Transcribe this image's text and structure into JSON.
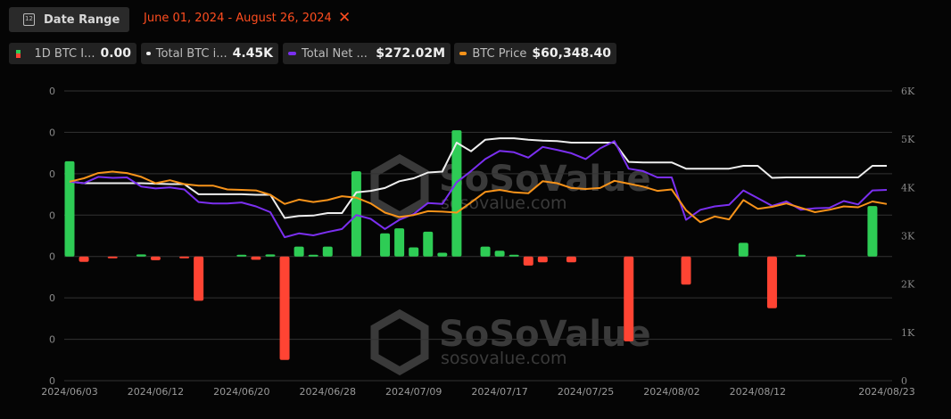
{
  "header": {
    "date_range_button": "Date Range",
    "calendar_icon_text": "12",
    "selected_range": "June 01, 2024 - August 26, 2024",
    "close_glyph": "✕"
  },
  "legend": [
    {
      "name": "1D BTC I...",
      "value": "0.00",
      "colors": [
        "#2ecc55",
        "#ff4433"
      ]
    },
    {
      "name": "Total BTC i...",
      "value": "4.45K",
      "color": "#eeeeee"
    },
    {
      "name": "Total Net ...",
      "value": "$272.02M",
      "color": "#7b2ff0"
    },
    {
      "name": "BTC Price",
      "value": "$60,348.40",
      "color": "#f7931a"
    }
  ],
  "watermark": {
    "brand": "SoSoValue",
    "url": "sosovalue.com"
  },
  "chart_data": {
    "type": "bar+line",
    "title": "",
    "left_axis": {
      "tick_labels": [
        "0",
        "0",
        "0",
        "0",
        "0",
        "0",
        "0",
        "0"
      ],
      "ylim": [
        -3,
        4
      ],
      "note": "bar units (gridline steps)"
    },
    "right_axis": {
      "tick_labels": [
        "6K",
        "5K",
        "4K",
        "3K",
        "2K",
        "1K",
        "0"
      ],
      "ylim": [
        0,
        6
      ]
    },
    "x_tick_labels": [
      {
        "index": 0,
        "label": "2024/06/03"
      },
      {
        "index": 6,
        "label": "2024/06/12"
      },
      {
        "index": 12,
        "label": "2024/06/20"
      },
      {
        "index": 18,
        "label": "2024/06/28"
      },
      {
        "index": 24,
        "label": "2024/07/09"
      },
      {
        "index": 30,
        "label": "2024/07/17"
      },
      {
        "index": 36,
        "label": "2024/07/25"
      },
      {
        "index": 42,
        "label": "2024/08/02"
      },
      {
        "index": 48,
        "label": "2024/08/12"
      },
      {
        "index": 57,
        "label": "2024/08/23"
      }
    ],
    "bars": {
      "name": "1D BTC Inflow",
      "positive_color": "#2ecc55",
      "negative_color": "#ff4433",
      "values": [
        2.3,
        -0.13,
        0,
        -0.02,
        0,
        0.05,
        -0.09,
        0,
        -0.01,
        -1.07,
        0,
        0,
        0.02,
        -0.08,
        0.05,
        -2.5,
        0.24,
        0.04,
        0.24,
        0,
        2.06,
        0,
        0.56,
        0.68,
        0.22,
        0.6,
        0.09,
        3.05,
        0,
        0.24,
        0.14,
        0.01,
        -0.22,
        -0.14,
        0,
        -0.14,
        0,
        0,
        0,
        -2.05,
        0,
        0,
        0,
        -0.68,
        0,
        0,
        0,
        0.33,
        0,
        -1.25,
        0,
        0.02,
        0,
        0,
        0,
        0,
        1.22,
        0
      ]
    },
    "series": [
      {
        "name": "Total BTC inflow (plotted on right axis, K)",
        "color": "#eeeeee",
        "values": [
          4.12,
          4.09,
          4.09,
          4.09,
          4.09,
          4.09,
          4.08,
          4.07,
          4.07,
          3.86,
          3.86,
          3.86,
          3.86,
          3.85,
          3.85,
          3.37,
          3.41,
          3.42,
          3.47,
          3.47,
          3.9,
          3.93,
          3.99,
          4.13,
          4.19,
          4.31,
          4.33,
          4.93,
          4.75,
          4.99,
          5.02,
          5.02,
          4.99,
          4.97,
          4.96,
          4.93,
          4.93,
          4.93,
          4.93,
          4.53,
          4.52,
          4.52,
          4.52,
          4.39,
          4.39,
          4.39,
          4.39,
          4.45,
          4.45,
          4.2,
          4.21,
          4.21,
          4.21,
          4.21,
          4.21,
          4.21,
          4.45,
          4.45
        ]
      },
      {
        "name": "Total Net Assets (plotted, right-axis units)",
        "color": "#7b2ff0",
        "values": [
          4.12,
          4.09,
          4.22,
          4.2,
          4.21,
          4.02,
          3.98,
          4.0,
          3.96,
          3.7,
          3.67,
          3.67,
          3.69,
          3.61,
          3.49,
          2.97,
          3.05,
          3.01,
          3.08,
          3.14,
          3.43,
          3.35,
          3.14,
          3.33,
          3.45,
          3.68,
          3.66,
          4.11,
          4.34,
          4.59,
          4.76,
          4.73,
          4.62,
          4.84,
          4.78,
          4.71,
          4.59,
          4.81,
          4.96,
          4.39,
          4.34,
          4.21,
          4.21,
          3.33,
          3.54,
          3.61,
          3.64,
          3.94,
          3.78,
          3.62,
          3.71,
          3.54,
          3.57,
          3.58,
          3.72,
          3.65,
          3.94,
          3.95
        ]
      },
      {
        "name": "BTC Price (plotted, right-axis units)",
        "color": "#f7931a",
        "values": [
          4.12,
          4.19,
          4.3,
          4.33,
          4.3,
          4.22,
          4.09,
          4.15,
          4.07,
          4.04,
          4.04,
          3.96,
          3.95,
          3.94,
          3.85,
          3.66,
          3.75,
          3.7,
          3.74,
          3.82,
          3.79,
          3.67,
          3.48,
          3.39,
          3.43,
          3.51,
          3.5,
          3.48,
          3.69,
          3.91,
          3.95,
          3.9,
          3.88,
          4.13,
          4.09,
          3.99,
          3.97,
          3.99,
          4.14,
          4.08,
          4.02,
          3.93,
          3.96,
          3.53,
          3.28,
          3.4,
          3.34,
          3.74,
          3.56,
          3.6,
          3.67,
          3.58,
          3.49,
          3.54,
          3.61,
          3.59,
          3.71,
          3.66
        ]
      }
    ],
    "grid": true
  }
}
